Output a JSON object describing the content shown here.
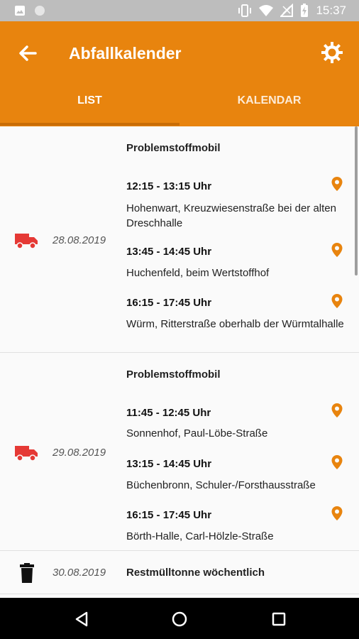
{
  "status_bar": {
    "time": "15:37"
  },
  "appbar": {
    "title": "Abfallkalender",
    "accent": "#e8840e"
  },
  "tabs": [
    {
      "label": "LIST",
      "selected": true
    },
    {
      "label": "KALENDAR",
      "selected": false
    }
  ],
  "rows": [
    {
      "icon": "truck-icon",
      "date": "28.08.2019",
      "title": "Problemstoffmobil",
      "slots": [
        {
          "time": "12:15 - 13:15 Uhr",
          "place": "Hohenwart, Kreuzwiesenstraße bei der alten Dreschhalle"
        },
        {
          "time": "13:45 - 14:45 Uhr",
          "place": "Huchenfeld, beim Wertstoffhof"
        },
        {
          "time": "16:15 - 17:45 Uhr",
          "place": "Würm, Ritterstraße oberhalb der Würmtalhalle"
        }
      ]
    },
    {
      "icon": "truck-icon",
      "date": "29.08.2019",
      "title": "Problemstoffmobil",
      "slots": [
        {
          "time": "11:45 - 12:45 Uhr",
          "place": "Sonnenhof, Paul-Löbe-Straße"
        },
        {
          "time": "13:15 - 14:45 Uhr",
          "place": "Büchenbronn, Schuler-/Forsthausstraße"
        },
        {
          "time": "16:15 - 17:45 Uhr",
          "place": "Börth-Halle, Carl-Hölzle-Straße"
        }
      ]
    },
    {
      "icon": "trash-bin-icon",
      "date": "30.08.2019",
      "title": "Restmülltonne wöchentlich",
      "slots": []
    }
  ]
}
